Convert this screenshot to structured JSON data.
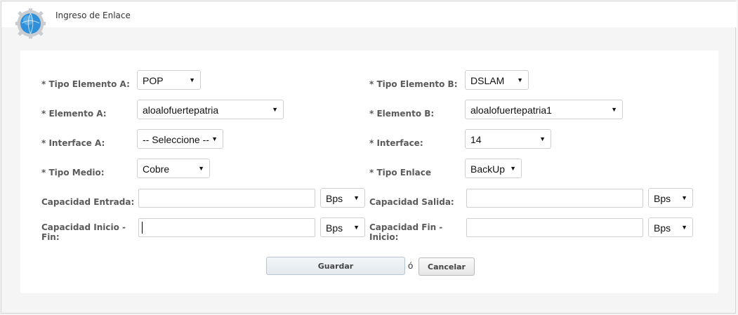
{
  "header": {
    "title": "Ingreso de Enlace"
  },
  "form": {
    "tipo_elemento_a": {
      "label": "* Tipo Elemento A:",
      "value": "POP"
    },
    "tipo_elemento_b": {
      "label": "* Tipo Elemento B:",
      "value": "DSLAM"
    },
    "elemento_a": {
      "label": "* Elemento A:",
      "value": "aloalofuertepatria"
    },
    "elemento_b": {
      "label": "* Elemento B:",
      "value": "aloalofuertepatria1"
    },
    "interface_a": {
      "label": "* Interface A:",
      "value": "-- Seleccione --"
    },
    "interface_b": {
      "label": "* Interface:",
      "value": "14"
    },
    "tipo_medio": {
      "label": "* Tipo Medio:",
      "value": "Cobre"
    },
    "tipo_enlace": {
      "label": "* Tipo Enlace",
      "value": "BackUp"
    },
    "capacidad_entrada": {
      "label": "Capacidad Entrada:",
      "value": "",
      "unit": "Bps"
    },
    "capacidad_salida": {
      "label": "Capacidad Salida:",
      "value": "",
      "unit": "Bps"
    },
    "capacidad_inicio_fin": {
      "label_line1": "Capacidad Inicio -",
      "label_line2": "Fin:",
      "value": "",
      "unit": "Bps"
    },
    "capacidad_fin_inicio": {
      "label_line1": "Capacidad Fin -",
      "label_line2": "Inicio:",
      "value": "",
      "unit": "Bps"
    }
  },
  "actions": {
    "save_label": "Guardar",
    "or_text": "ó",
    "cancel_label": "Cancelar"
  },
  "icons": {
    "logo": "globe-gear-icon",
    "dropdown": "triangle-down-icon"
  },
  "colors": {
    "label": "#5a5a5a",
    "panel_bg": "#ffffff",
    "page_bg": "#f5f5f5",
    "globe": "#2f8fd8"
  }
}
